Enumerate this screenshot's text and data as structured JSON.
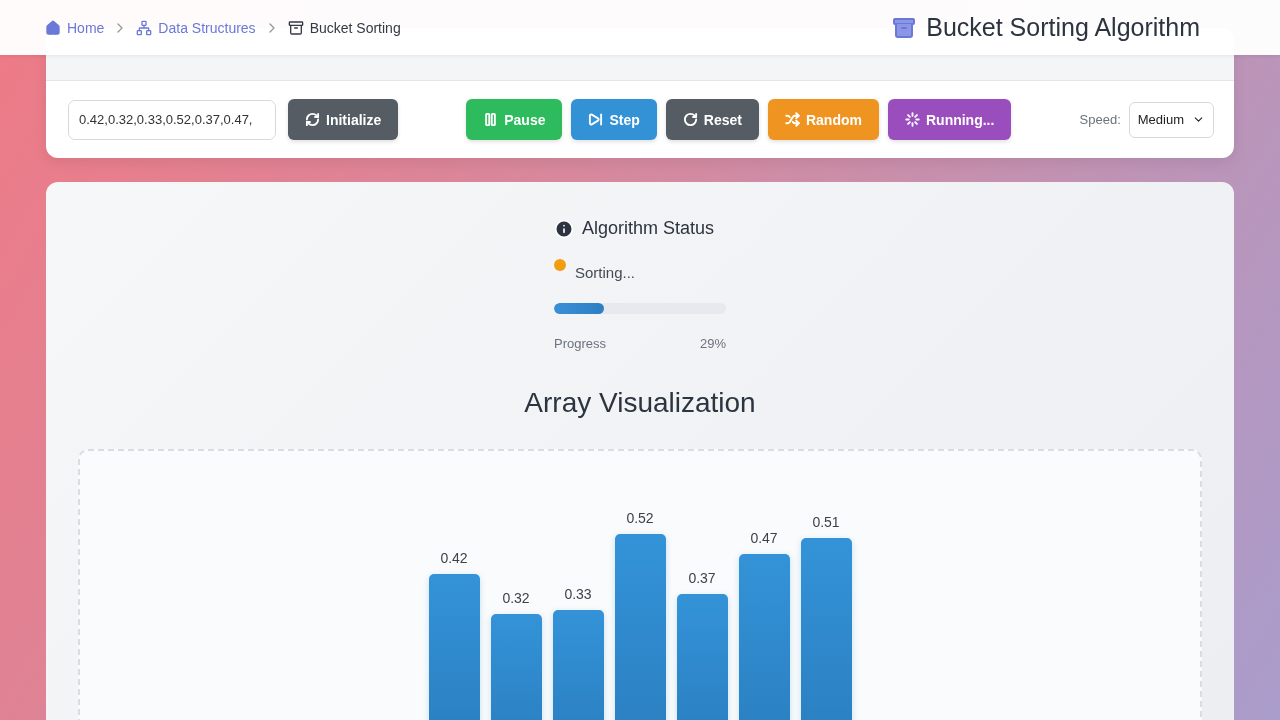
{
  "breadcrumb": [
    {
      "label": "Home",
      "current": false
    },
    {
      "label": "Data Structures",
      "current": false
    },
    {
      "label": "Bucket Sorting",
      "current": true
    }
  ],
  "page_title": "Bucket Sorting Algorithm",
  "controls": {
    "input": {
      "value": "0.42,0.32,0.33,0.52,0.37,0.47,"
    },
    "buttons": [
      {
        "label": "Initialize",
        "color": "#555c64"
      },
      {
        "label": "Pause",
        "color": "#2dbb5d"
      },
      {
        "label": "Step",
        "color": "#3391d6"
      },
      {
        "label": "Reset",
        "color": "#555c64"
      },
      {
        "label": "Random",
        "color": "#ef9420"
      },
      {
        "label": "Running...",
        "color": "#9a4dbd"
      }
    ],
    "speed": {
      "label": "Speed:",
      "value": "Medium"
    }
  },
  "status": {
    "title": "Algorithm Status",
    "state": "Sorting...",
    "color": "#f39c12",
    "level": 0.29,
    "progress_label": "Progress",
    "progress_value": "29%"
  },
  "visualization": {
    "title": "Array Visualization",
    "array": [
      {
        "value": "0.42"
      },
      {
        "value": "0.32"
      },
      {
        "value": "0.33"
      },
      {
        "value": "0.52"
      },
      {
        "value": "0.37"
      },
      {
        "value": "0.47"
      },
      {
        "value": "0.51"
      }
    ]
  }
}
